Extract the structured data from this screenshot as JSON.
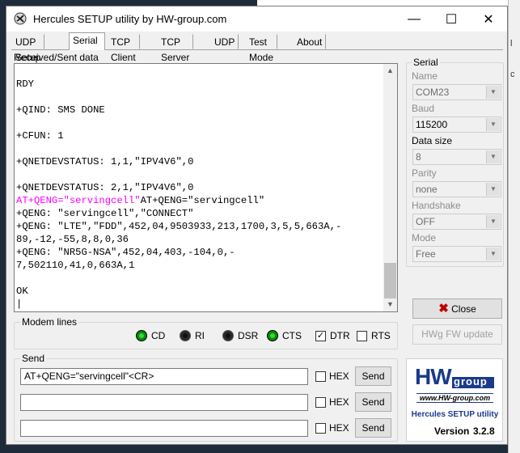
{
  "background": {
    "right_edge_labels": [
      "l",
      "c"
    ]
  },
  "window": {
    "title": "Hercules SETUP utility by HW-group.com",
    "minimize": "—",
    "maximize": "☐",
    "close": "✕"
  },
  "tabs": [
    "UDP Setup",
    "Serial",
    "TCP Client",
    "TCP Server",
    "UDP",
    "Test Mode",
    "About"
  ],
  "active_tab": "Serial",
  "received": {
    "label": "Received/Sent data",
    "lines": [
      {
        "text": "",
        "color": "black"
      },
      {
        "text": "RDY",
        "color": "black"
      },
      {
        "text": "",
        "color": "black"
      },
      {
        "text": "+QIND: SMS DONE",
        "color": "black"
      },
      {
        "text": "",
        "color": "black"
      },
      {
        "text": "+CFUN: 1",
        "color": "black"
      },
      {
        "text": "",
        "color": "black"
      },
      {
        "text": "+QNETDEVSTATUS: 1,1,\"IPV4V6\",0",
        "color": "black"
      },
      {
        "text": "",
        "color": "black"
      },
      {
        "text": "+QNETDEVSTATUS: 2,1,\"IPV4V6\",0",
        "color": "black"
      },
      {
        "text": "AT+QENG=\"servingcell\"",
        "color": "magenta",
        "tail": "AT+QENG=\"servingcell\""
      },
      {
        "text": "+QENG: \"servingcell\",\"CONNECT\"",
        "color": "black"
      },
      {
        "text": "+QENG: \"LTE\",\"FDD\",452,04,9503933,213,1700,3,5,5,663A,-",
        "color": "black"
      },
      {
        "text": "89,-12,-55,8,8,0,36",
        "color": "black"
      },
      {
        "text": "+QENG: \"NR5G-NSA\",452,04,403,-104,0,-",
        "color": "black"
      },
      {
        "text": "7,502110,41,0,663A,1",
        "color": "black"
      },
      {
        "text": "",
        "color": "black"
      },
      {
        "text": "OK",
        "color": "black"
      },
      {
        "text": "|",
        "color": "black"
      }
    ]
  },
  "serial": {
    "title": "Serial",
    "name_label": "Name",
    "name_value": "COM23",
    "baud_label": "Baud",
    "baud_value": "115200",
    "datasize_label": "Data size",
    "datasize_value": "8",
    "parity_label": "Parity",
    "parity_value": "none",
    "handshake_label": "Handshake",
    "handshake_value": "OFF",
    "mode_label": "Mode",
    "mode_value": "Free"
  },
  "close_button": "Close",
  "fw_button": "HWg FW update",
  "modem": {
    "title": "Modem lines",
    "leds": [
      {
        "label": "CD",
        "on": true
      },
      {
        "label": "RI",
        "on": false
      },
      {
        "label": "DSR",
        "on": false
      },
      {
        "label": "CTS",
        "on": true
      }
    ],
    "checks": [
      {
        "label": "DTR",
        "checked": true
      },
      {
        "label": "RTS",
        "checked": false
      }
    ]
  },
  "send": {
    "title": "Send",
    "rows": [
      {
        "value": "AT+QENG=\"servingcell\"<CR>",
        "hex": "HEX",
        "button": "Send"
      },
      {
        "value": "",
        "hex": "HEX",
        "button": "Send"
      },
      {
        "value": "",
        "hex": "HEX",
        "button": "Send"
      }
    ]
  },
  "logo": {
    "brand_hw": "HW",
    "brand_group": "group",
    "url": "www.HW-group.com",
    "product": "Hercules SETUP utility",
    "version_label": "Version",
    "version": "3.2.8"
  },
  "colors": {
    "magenta": "#ff00ff",
    "led_on": "#0a8a0a",
    "logo_blue": "#1a3a8a",
    "close_x": "#c00000"
  }
}
